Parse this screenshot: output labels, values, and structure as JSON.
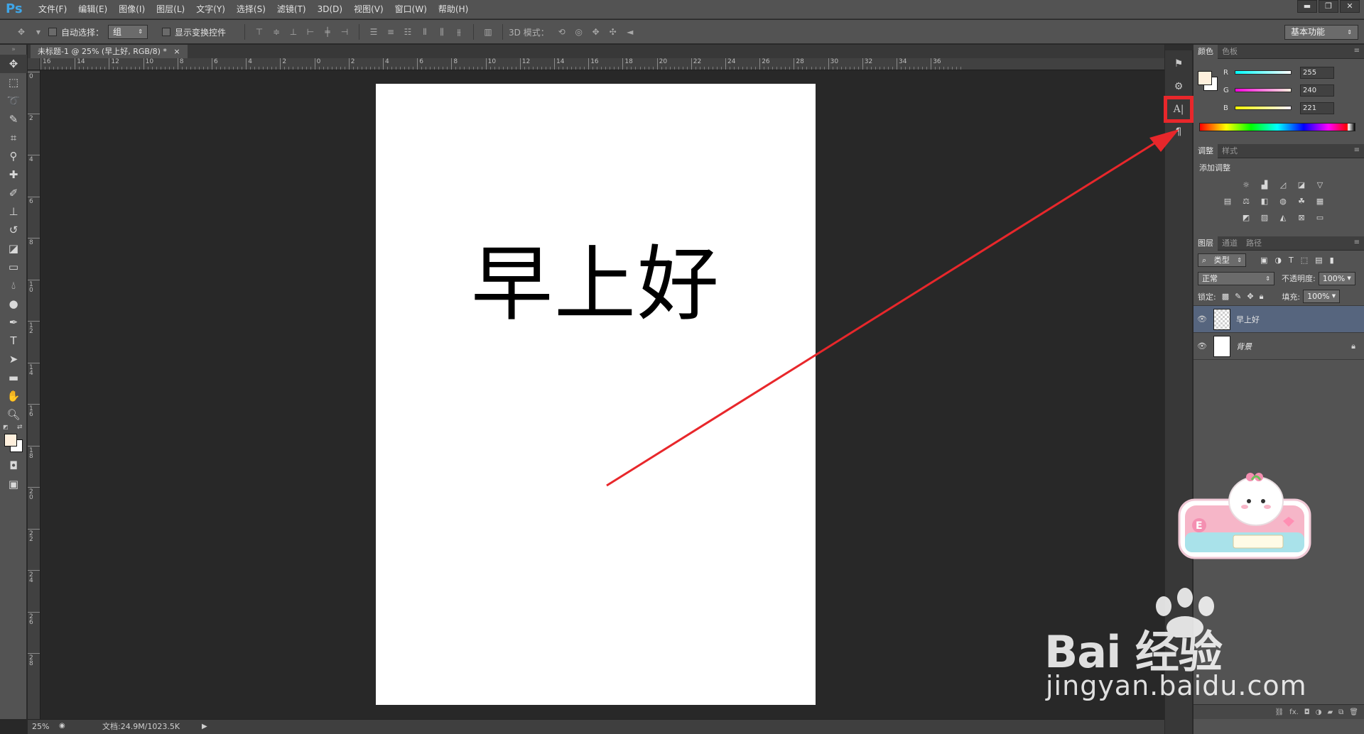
{
  "app": {
    "logo": "Ps",
    "menu": [
      "文件(F)",
      "编辑(E)",
      "图像(I)",
      "图层(L)",
      "文字(Y)",
      "选择(S)",
      "滤镜(T)",
      "3D(D)",
      "视图(V)",
      "窗口(W)",
      "帮助(H)"
    ],
    "window_buttons": {
      "minimize": "▬",
      "restore": "❐",
      "close": "✕"
    }
  },
  "options_bar": {
    "auto_select_label": "自动选择：",
    "auto_select_value": "组",
    "show_transform_label": "显示变换控件",
    "mode_3d_label": "3D 模式：",
    "workspace_value": "基本功能"
  },
  "document": {
    "tab_title": "未标题-1 @ 25% (早上好, RGB/8) *",
    "tab_close": "×",
    "canvas_text": "早上好"
  },
  "rulers": {
    "h_labels": [
      "16",
      "14",
      "12",
      "10",
      "8",
      "6",
      "4",
      "2",
      "0",
      "2",
      "4",
      "6",
      "8",
      "10",
      "12",
      "14",
      "16",
      "18",
      "20",
      "22",
      "24",
      "26",
      "28",
      "30",
      "32",
      "34",
      "36"
    ],
    "v_labels": [
      "0",
      "2",
      "4",
      "6",
      "8",
      "10",
      "12",
      "14",
      "16",
      "18",
      "20",
      "22",
      "24",
      "26",
      "28"
    ]
  },
  "status": {
    "zoom": "25%",
    "doc_info": "文档:24.9M/1023.5K",
    "arrow": "▶"
  },
  "color_panel": {
    "tabs": [
      "颜色",
      "色板"
    ],
    "channels": [
      {
        "label": "R",
        "value": "255",
        "color_from": "#00ffff",
        "color_to": "#ffffff"
      },
      {
        "label": "G",
        "value": "240",
        "color_from": "#ff00dd",
        "color_to": "#fff0dd"
      },
      {
        "label": "B",
        "value": "221",
        "color_from": "#ffff00",
        "color_to": "#fff0ff"
      }
    ],
    "foreground": "#fff0dd",
    "background": "#ffffff"
  },
  "adjustments_panel": {
    "tabs": [
      "调整",
      "样式"
    ],
    "title": "添加调整"
  },
  "layers_panel": {
    "tabs": [
      "图层",
      "通道",
      "路径"
    ],
    "filter_kind": "类型",
    "blend_mode": "正常",
    "opacity_label": "不透明度:",
    "opacity_value": "100%",
    "lock_label": "锁定:",
    "fill_label": "填充:",
    "fill_value": "100%",
    "layers": [
      {
        "name": "早上好",
        "selected": true
      },
      {
        "name": "背景",
        "locked": true
      }
    ],
    "footer_fx": "fx."
  },
  "watermark": {
    "brand": "Bai  经验",
    "url": "jingyan.baidu.com"
  },
  "colors": {
    "highlight": "#e8272b",
    "selection": "#56657e"
  }
}
